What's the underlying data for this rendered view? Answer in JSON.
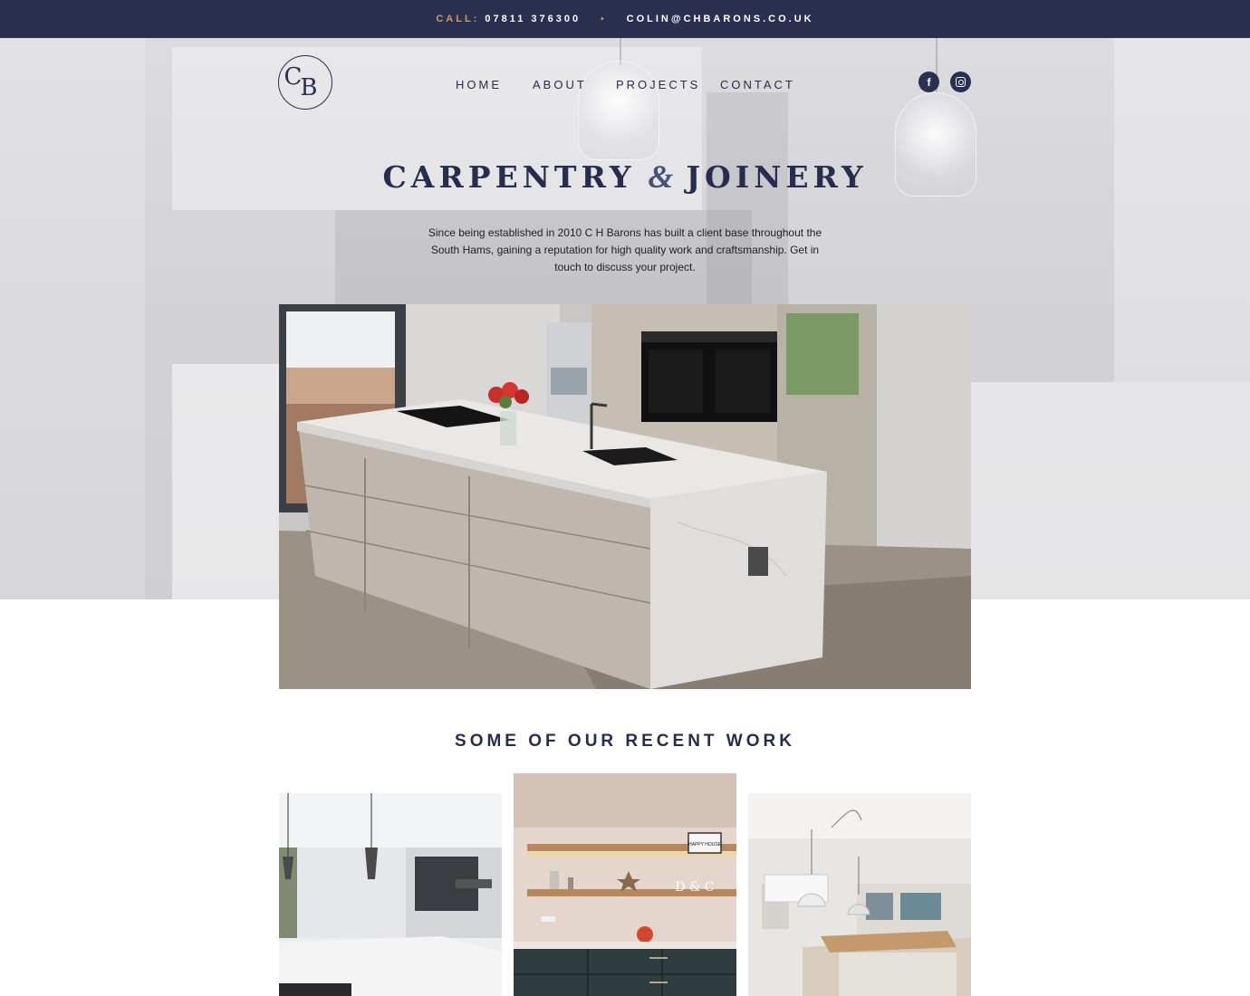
{
  "topbar": {
    "call_label": "CALL:",
    "phone": "07811 376300",
    "separator": "•",
    "email": "COLIN@CHBARONS.CO.UK"
  },
  "header": {
    "logo_letters": [
      "C",
      "B"
    ],
    "nav": [
      {
        "label": "HOME"
      },
      {
        "label": "ABOUT"
      },
      {
        "label": "PROJECTS"
      },
      {
        "label": "CONTACT"
      }
    ],
    "social": [
      {
        "icon": "facebook-icon",
        "glyph": "f"
      },
      {
        "icon": "instagram-icon"
      }
    ]
  },
  "hero": {
    "title_part1": "CARPENTRY",
    "title_amp": "&",
    "title_part2": "JOINERY",
    "intro": "Since being established in 2010 C H Barons has built a client base throughout the South Hams, gaining a reputation for high quality work and craftsmanship. Get in touch to discuss your project."
  },
  "recent": {
    "title": "SOME OF OUR RECENT WORK",
    "thumb3_letters": "D & C",
    "thumb2_sign": "HAPPY HOUSE"
  },
  "colors": {
    "navy": "#2b3050",
    "accent": "#c99a6a"
  }
}
